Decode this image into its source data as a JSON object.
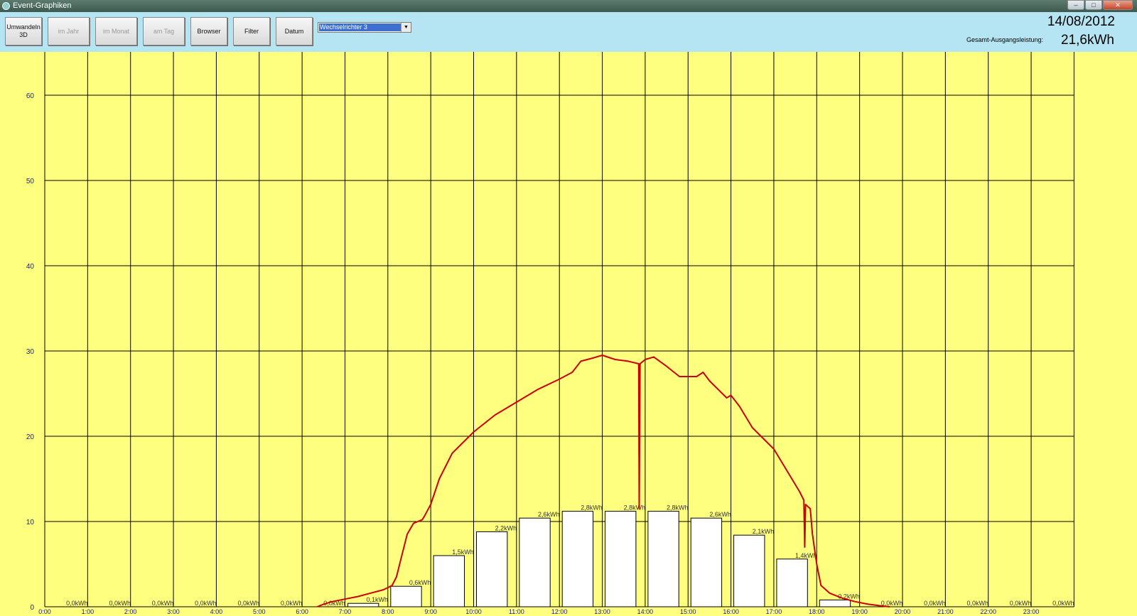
{
  "window": {
    "title": "Event-Graphiken",
    "controls": [
      "–",
      "□",
      "✕"
    ]
  },
  "toolbar": {
    "buttons": [
      {
        "label": "Umwandeln\n3D",
        "enabled": true
      },
      {
        "label": "im Jahr",
        "enabled": false
      },
      {
        "label": "im Monat",
        "enabled": false
      },
      {
        "label": "am Tag",
        "enabled": false
      },
      {
        "label": "Browser",
        "enabled": true
      },
      {
        "label": "Filter",
        "enabled": true
      },
      {
        "label": "Datum",
        "enabled": true
      }
    ],
    "inverter_select": {
      "selected": "Wechselrichter 3"
    }
  },
  "header": {
    "date": "14/08/2012",
    "total_label": "Gesamt-Ausgangsleistung:",
    "total_value": "21,6kWh"
  },
  "colors": {
    "background": "#ffff7f",
    "line": "#cc0000",
    "bar": "#ffffff",
    "grid": "#000000",
    "axis_text": "#1a1a8c"
  },
  "chart_data": {
    "type": "bar+line",
    "y_ticks": [
      "0",
      "10",
      "20",
      "30",
      "40",
      "50",
      "60"
    ],
    "ylim": [
      0,
      65
    ],
    "x_ticks": [
      "0:00",
      "1:00",
      "2:00",
      "3:00",
      "4:00",
      "5:00",
      "6:00",
      "7:00",
      "8:00",
      "9:00",
      "10:00",
      "11:00",
      "12:00",
      "13:00",
      "14:00",
      "15:00",
      "16:00",
      "17:00",
      "18:00",
      "19:00",
      "20:00",
      "21:00",
      "22:00",
      "23:00"
    ],
    "grid": true,
    "bars": {
      "hours": [
        0,
        1,
        2,
        3,
        4,
        5,
        6,
        7,
        8,
        9,
        10,
        11,
        12,
        13,
        14,
        15,
        16,
        17,
        18,
        19,
        20,
        21,
        22,
        23
      ],
      "values": [
        0,
        0,
        0,
        0,
        0,
        0,
        0,
        0.1,
        0.6,
        1.5,
        2.2,
        2.6,
        2.8,
        2.8,
        2.8,
        2.6,
        2.1,
        1.4,
        0.2,
        0,
        0,
        0,
        0,
        0
      ],
      "labels": [
        "0,0kWh",
        "0,0kWh",
        "0,0kWh",
        "0,0kWh",
        "0,0kWh",
        "0,0kWh",
        "0,0kWh",
        "0,1kWh",
        "0,6kWh",
        "1,5kWh",
        "2,2kWh",
        "2,6kWh",
        "2,8kWh",
        "2,8kWh",
        "2,8kWh",
        "2,6kWh",
        "2,1kWh",
        "1,4kWh",
        "0,2kWh",
        "0,0kWh",
        "0,0kWh",
        "0,0kWh",
        "0,0kWh",
        "0,0kWh"
      ],
      "chart_value_per_kwh": 4
    },
    "line": {
      "points": [
        [
          6.35,
          0
        ],
        [
          6.5,
          0.3
        ],
        [
          6.7,
          0.6
        ],
        [
          7.0,
          0.9
        ],
        [
          7.3,
          1.2
        ],
        [
          7.6,
          1.6
        ],
        [
          7.9,
          2.0
        ],
        [
          8.1,
          2.5
        ],
        [
          8.2,
          3.5
        ],
        [
          8.3,
          5.5
        ],
        [
          8.45,
          8.5
        ],
        [
          8.6,
          9.8
        ],
        [
          8.8,
          10.2
        ],
        [
          8.85,
          10.6
        ],
        [
          9.0,
          12.0
        ],
        [
          9.2,
          15.0
        ],
        [
          9.5,
          18.0
        ],
        [
          9.8,
          19.5
        ],
        [
          10.0,
          20.5
        ],
        [
          10.5,
          22.5
        ],
        [
          11.0,
          24.0
        ],
        [
          11.5,
          25.5
        ],
        [
          12.0,
          26.7
        ],
        [
          12.3,
          27.5
        ],
        [
          12.5,
          28.8
        ],
        [
          12.8,
          29.2
        ],
        [
          13.0,
          29.5
        ],
        [
          13.3,
          29.0
        ],
        [
          13.6,
          28.8
        ],
        [
          13.85,
          28.5
        ],
        [
          13.86,
          11.5
        ],
        [
          13.88,
          28.5
        ],
        [
          14.0,
          29.0
        ],
        [
          14.2,
          29.3
        ],
        [
          14.5,
          28.2
        ],
        [
          14.8,
          27.0
        ],
        [
          15.0,
          27.0
        ],
        [
          15.2,
          27.0
        ],
        [
          15.35,
          27.5
        ],
        [
          15.5,
          26.5
        ],
        [
          15.7,
          25.5
        ],
        [
          15.9,
          24.5
        ],
        [
          16.0,
          24.8
        ],
        [
          16.2,
          23.5
        ],
        [
          16.5,
          21.0
        ],
        [
          16.8,
          19.5
        ],
        [
          17.0,
          18.5
        ],
        [
          17.3,
          16.0
        ],
        [
          17.6,
          13.5
        ],
        [
          17.7,
          12.5
        ],
        [
          17.72,
          7.0
        ],
        [
          17.74,
          12.0
        ],
        [
          17.85,
          11.5
        ],
        [
          17.9,
          8.5
        ],
        [
          18.0,
          5.0
        ],
        [
          18.1,
          2.5
        ],
        [
          18.3,
          1.6
        ],
        [
          18.6,
          1.0
        ],
        [
          18.9,
          0.6
        ],
        [
          19.2,
          0.3
        ],
        [
          19.5,
          0.1
        ],
        [
          19.7,
          0
        ]
      ]
    }
  }
}
